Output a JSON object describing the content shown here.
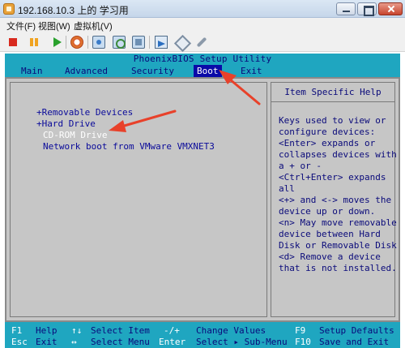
{
  "window": {
    "title": "192.168.10.3 上的 学习用",
    "icon": "vmware-app-icon",
    "controls": [
      "minimize-icon",
      "maximize-icon",
      "close-icon"
    ]
  },
  "menubar": {
    "items": [
      "文件(F)",
      "视图(W)",
      "虚拟机(V)"
    ]
  },
  "toolbar": {
    "icons": [
      "stop-icon",
      "pause-icon",
      "play-icon",
      "reset-icon",
      "snapshot-icon",
      "revert-snapshot-icon",
      "manage-snapshots-icon",
      "fullscreen-icon",
      "unity-icon",
      "preferences-icon"
    ]
  },
  "bios": {
    "header": "PhoenixBIOS Setup Utility",
    "tabs": [
      "Main",
      "Advanced",
      "Security",
      "Boot",
      "Exit"
    ],
    "active_tab": "Boot",
    "boot_items": [
      "+Removable Devices",
      "+Hard Drive",
      "CD-ROM Drive",
      "Network boot from VMware VMXNET3"
    ],
    "selected_item": "CD-ROM Drive",
    "help_title": "Item Specific Help",
    "help_lines": [
      "Keys used to view or",
      "configure devices:",
      "<Enter> expands or",
      "collapses devices with",
      "a + or -",
      "<Ctrl+Enter> expands",
      "all",
      "<+> and <-> moves the",
      "device up or down.",
      "<n> May move removable",
      "device between Hard",
      "Disk or Removable Disk",
      "<d> Remove a device",
      "that is not installed."
    ],
    "footer": {
      "row1": [
        {
          "key": "F1",
          "desc": "Help"
        },
        {
          "key": "↑↓",
          "desc": "Select Item"
        },
        {
          "key": "-/+",
          "desc": "Change Values"
        },
        {
          "key": "F9",
          "desc": "Setup Defaults"
        }
      ],
      "row2": [
        {
          "key": "Esc",
          "desc": "Exit"
        },
        {
          "key": "↔",
          "desc": "Select Menu"
        },
        {
          "key": "Enter",
          "desc": "Select ▸ Sub-Menu"
        },
        {
          "key": "F10",
          "desc": "Save and Exit"
        }
      ]
    },
    "colors": {
      "background": "#0a0aa8",
      "bar": "#1fa6c0",
      "panel": "#c6c6c6",
      "annotation_arrow": "#e8412a"
    }
  }
}
